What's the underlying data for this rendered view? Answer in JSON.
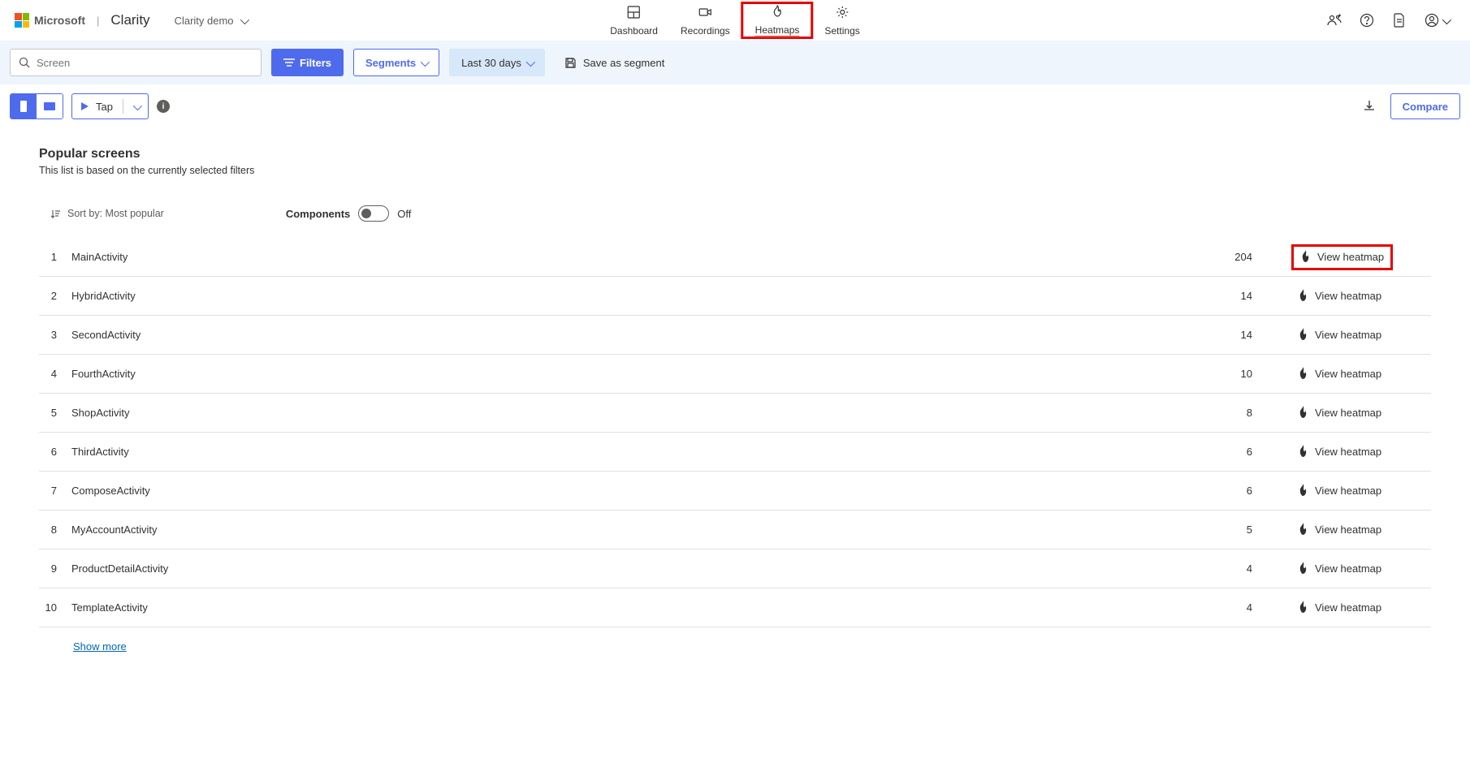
{
  "header": {
    "ms_label": "Microsoft",
    "product": "Clarity",
    "project_name": "Clarity demo",
    "tabs": [
      {
        "label": "Dashboard",
        "icon": "grid"
      },
      {
        "label": "Recordings",
        "icon": "video"
      },
      {
        "label": "Heatmaps",
        "icon": "flame",
        "active": true,
        "highlighted": true
      },
      {
        "label": "Settings",
        "icon": "gear"
      }
    ]
  },
  "filters": {
    "search_placeholder": "Screen",
    "filters_btn": "Filters",
    "segments_btn": "Segments",
    "date_range": "Last 30 days",
    "save_segment": "Save as segment"
  },
  "viewbar": {
    "tap_label": "Tap",
    "compare_label": "Compare"
  },
  "content": {
    "title": "Popular screens",
    "subtitle": "This list is based on the currently selected filters",
    "sort_label": "Sort by: Most popular",
    "components_label": "Components",
    "toggle_state": "Off",
    "view_heatmap_label": "View heatmap",
    "show_more": "Show more",
    "screens": [
      {
        "idx": "1",
        "name": "MainActivity",
        "count": "204",
        "highlighted": true
      },
      {
        "idx": "2",
        "name": "HybridActivity",
        "count": "14"
      },
      {
        "idx": "3",
        "name": "SecondActivity",
        "count": "14"
      },
      {
        "idx": "4",
        "name": "FourthActivity",
        "count": "10"
      },
      {
        "idx": "5",
        "name": "ShopActivity",
        "count": "8"
      },
      {
        "idx": "6",
        "name": "ThirdActivity",
        "count": "6"
      },
      {
        "idx": "7",
        "name": "ComposeActivity",
        "count": "6"
      },
      {
        "idx": "8",
        "name": "MyAccountActivity",
        "count": "5"
      },
      {
        "idx": "9",
        "name": "ProductDetailActivity",
        "count": "4"
      },
      {
        "idx": "10",
        "name": "TemplateActivity",
        "count": "4"
      }
    ]
  }
}
